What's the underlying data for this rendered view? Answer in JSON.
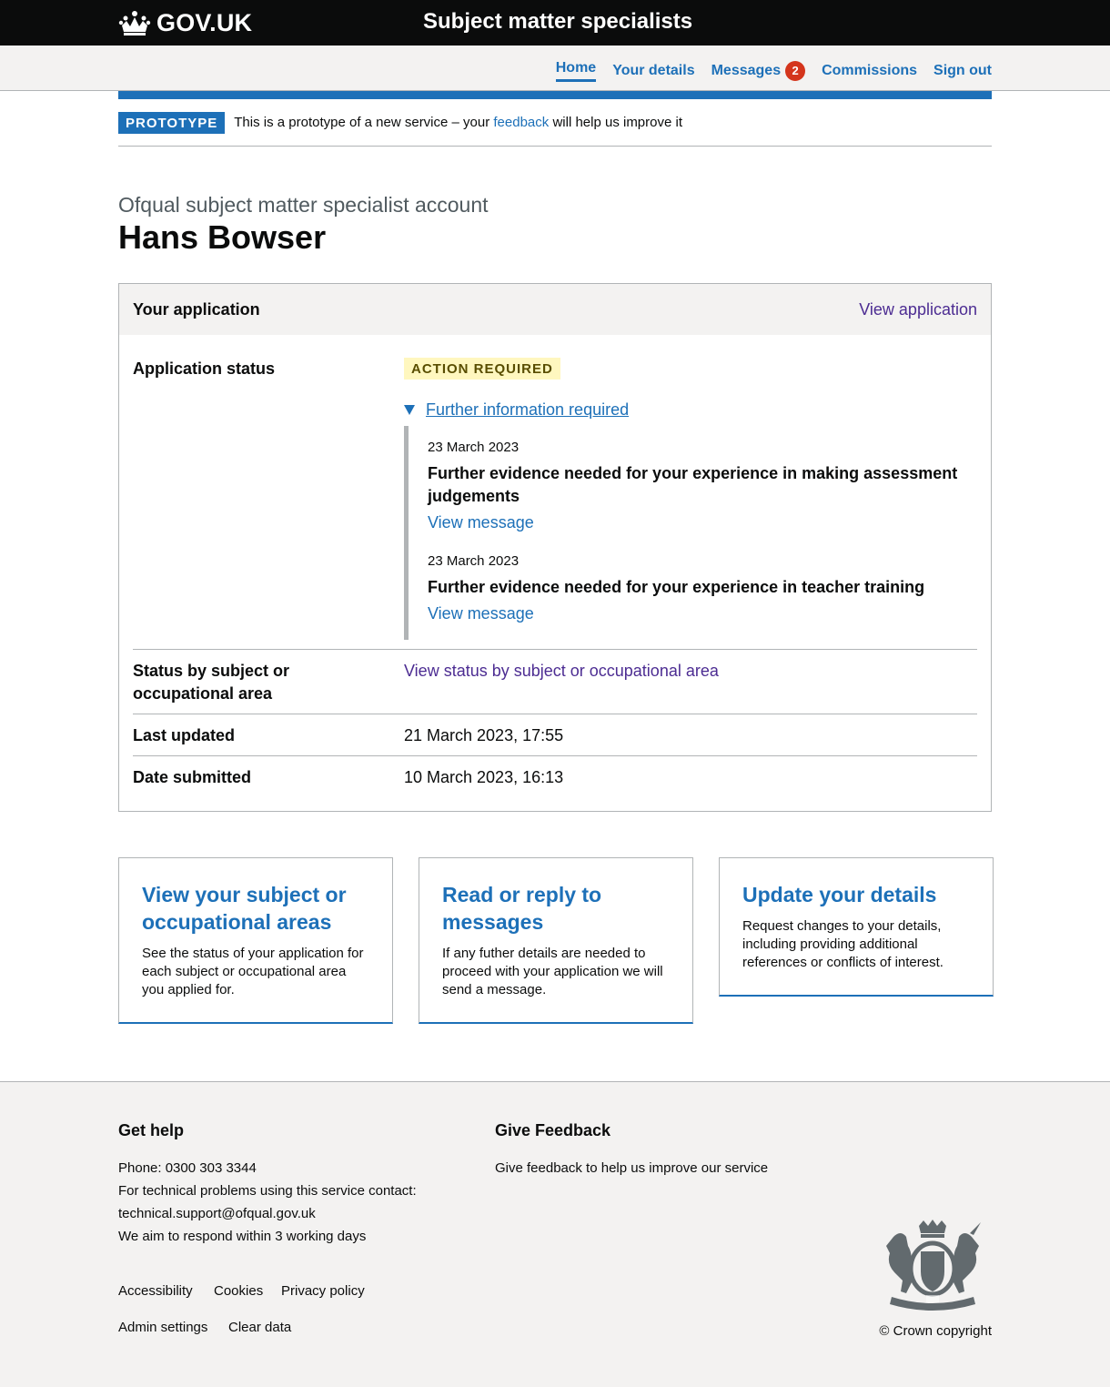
{
  "header": {
    "logo_text": "GOV.UK",
    "service_name": "Subject matter specialists"
  },
  "nav": {
    "items": [
      {
        "label": "Home",
        "active": true
      },
      {
        "label": "Your details"
      },
      {
        "label": "Messages",
        "badge": "2"
      },
      {
        "label": "Commissions"
      },
      {
        "label": "Sign out"
      }
    ]
  },
  "phase_banner": {
    "tag": "PROTOTYPE",
    "text_before": "This is a prototype of a new service – your ",
    "link": "feedback",
    "text_after": " will help us improve it"
  },
  "page": {
    "caption": "Ofqual subject matter specialist account",
    "title": "Hans Bowser"
  },
  "application_card": {
    "title": "Your application",
    "view_link": "View application",
    "status_label": "Application status",
    "status_tag": "ACTION REQUIRED",
    "details_summary": "Further information required",
    "messages": [
      {
        "date": "23 March 2023",
        "title": "Further evidence needed for your experience in making assessment judgements",
        "link": "View message"
      },
      {
        "date": "23 March 2023",
        "title": "Further evidence needed for your experience in teacher training",
        "link": "View message"
      }
    ],
    "subject_status_label": "Status by subject or occupational area",
    "subject_status_link": "View status by subject or occupational area",
    "last_updated_label": "Last updated",
    "last_updated_value": "21 March 2023, 17:55",
    "date_submitted_label": "Date submitted",
    "date_submitted_value": "10 March 2023, 16:13"
  },
  "tiles": [
    {
      "title": "View your subject or occupational areas",
      "description": "See the status of your application for each subject or occupational area you applied for."
    },
    {
      "title": "Read or reply to messages",
      "description": "If any futher details are needed to proceed with your application we will send a message."
    },
    {
      "title": "Update your details",
      "description": "Request changes to your details, including providing additional references or conflicts of interest."
    }
  ],
  "footer": {
    "help_heading": "Get help",
    "phone_label": "Phone: ",
    "phone_number": "0300 303 3344",
    "tech_text": "For technical problems using this service contact:",
    "email": "technical.support@ofqual.gov.uk",
    "response_text": "We aim to respond within 3 working days",
    "feedback_heading": "Give Feedback",
    "feedback_link": "Give feedback to help us improve our service",
    "links_row1": [
      "Accessibility",
      "Cookies",
      "Privacy policy"
    ],
    "links_row2": [
      "Admin settings",
      "Clear data"
    ],
    "copyright": "© Crown copyright"
  },
  "colors": {
    "brand_blue": "#1d70b8",
    "visited_purple": "#4c2c92",
    "header_black": "#0b0c0c",
    "tag_yellow_bg": "#fff7bf",
    "badge_red": "#d4351c"
  },
  "icons": {
    "logo": "crown-icon",
    "footer_crest": "royal-coat-of-arms-icon",
    "details_toggle": "triangle-down-icon"
  }
}
